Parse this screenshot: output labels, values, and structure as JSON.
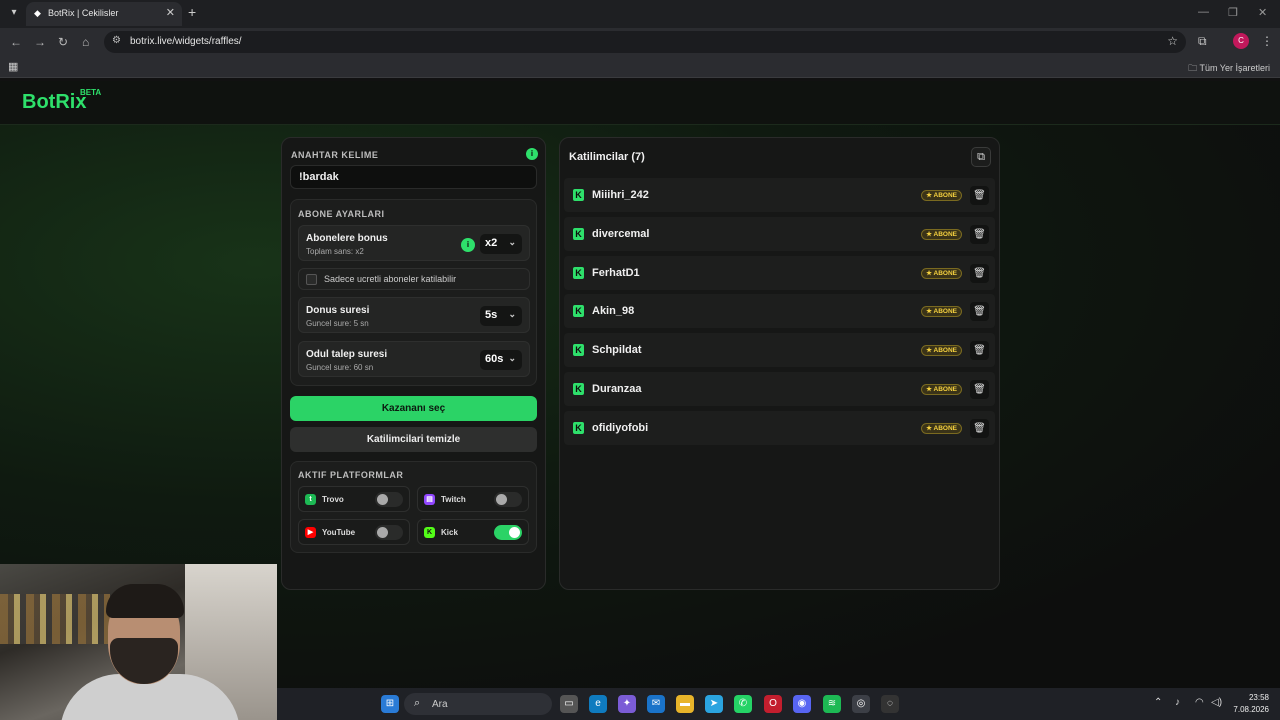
{
  "browser": {
    "tab_title": "BotRix | Cekilisler",
    "url": "botrix.live/widgets/raffles/",
    "bookmarks_all": "Tüm Yer İşaretleri",
    "profile_initial": "C"
  },
  "app": {
    "logo": "BotRix",
    "beta": "BETA"
  },
  "left": {
    "keyword_label": "ANAHTAR KELIME",
    "keyword_value": "!bardak",
    "sub_settings_label": "ABONE AYARLARI",
    "bonus_title": "Abonelere bonus",
    "bonus_sub": "Toplam sans: x2",
    "bonus_value": "x2",
    "paid_only_label": "Sadece ucretli aboneler katilabilir",
    "paid_only_checked": false,
    "bonus_time_title": "Donus suresi",
    "bonus_time_sub": "Guncel sure: 5 sn",
    "bonus_time_value": "5s",
    "claim_time_title": "Odul talep suresi",
    "claim_time_sub": "Guncel sure: 60 sn",
    "claim_time_value": "60s",
    "pick_winner": "Kazananı seç",
    "clear_participants": "Katilimcilari temizle",
    "platforms_label": "AKTIF PLATFORMLAR",
    "platforms": [
      {
        "name": "Trovo",
        "enabled": false,
        "color": "#1db954"
      },
      {
        "name": "Twitch",
        "enabled": false,
        "color": "#9146ff"
      },
      {
        "name": "YouTube",
        "enabled": false,
        "color": "#ff0000"
      },
      {
        "name": "Kick",
        "enabled": true,
        "color": "#53fc18"
      }
    ]
  },
  "right": {
    "title": "Katilimcilar (7)",
    "badge_label": "ABONE",
    "participants": [
      {
        "name": "Miiihri_242"
      },
      {
        "name": "divercemal"
      },
      {
        "name": "FerhatD1"
      },
      {
        "name": "Akin_98"
      },
      {
        "name": "Schpildat"
      },
      {
        "name": "Duranzaa"
      },
      {
        "name": "ofidiyofobi"
      }
    ]
  },
  "taskbar": {
    "search_placeholder": "Ara",
    "time": "23:58",
    "date": "7.08.2026"
  },
  "colors": {
    "accent": "#2ee06b",
    "badge": "#f4d03f"
  }
}
